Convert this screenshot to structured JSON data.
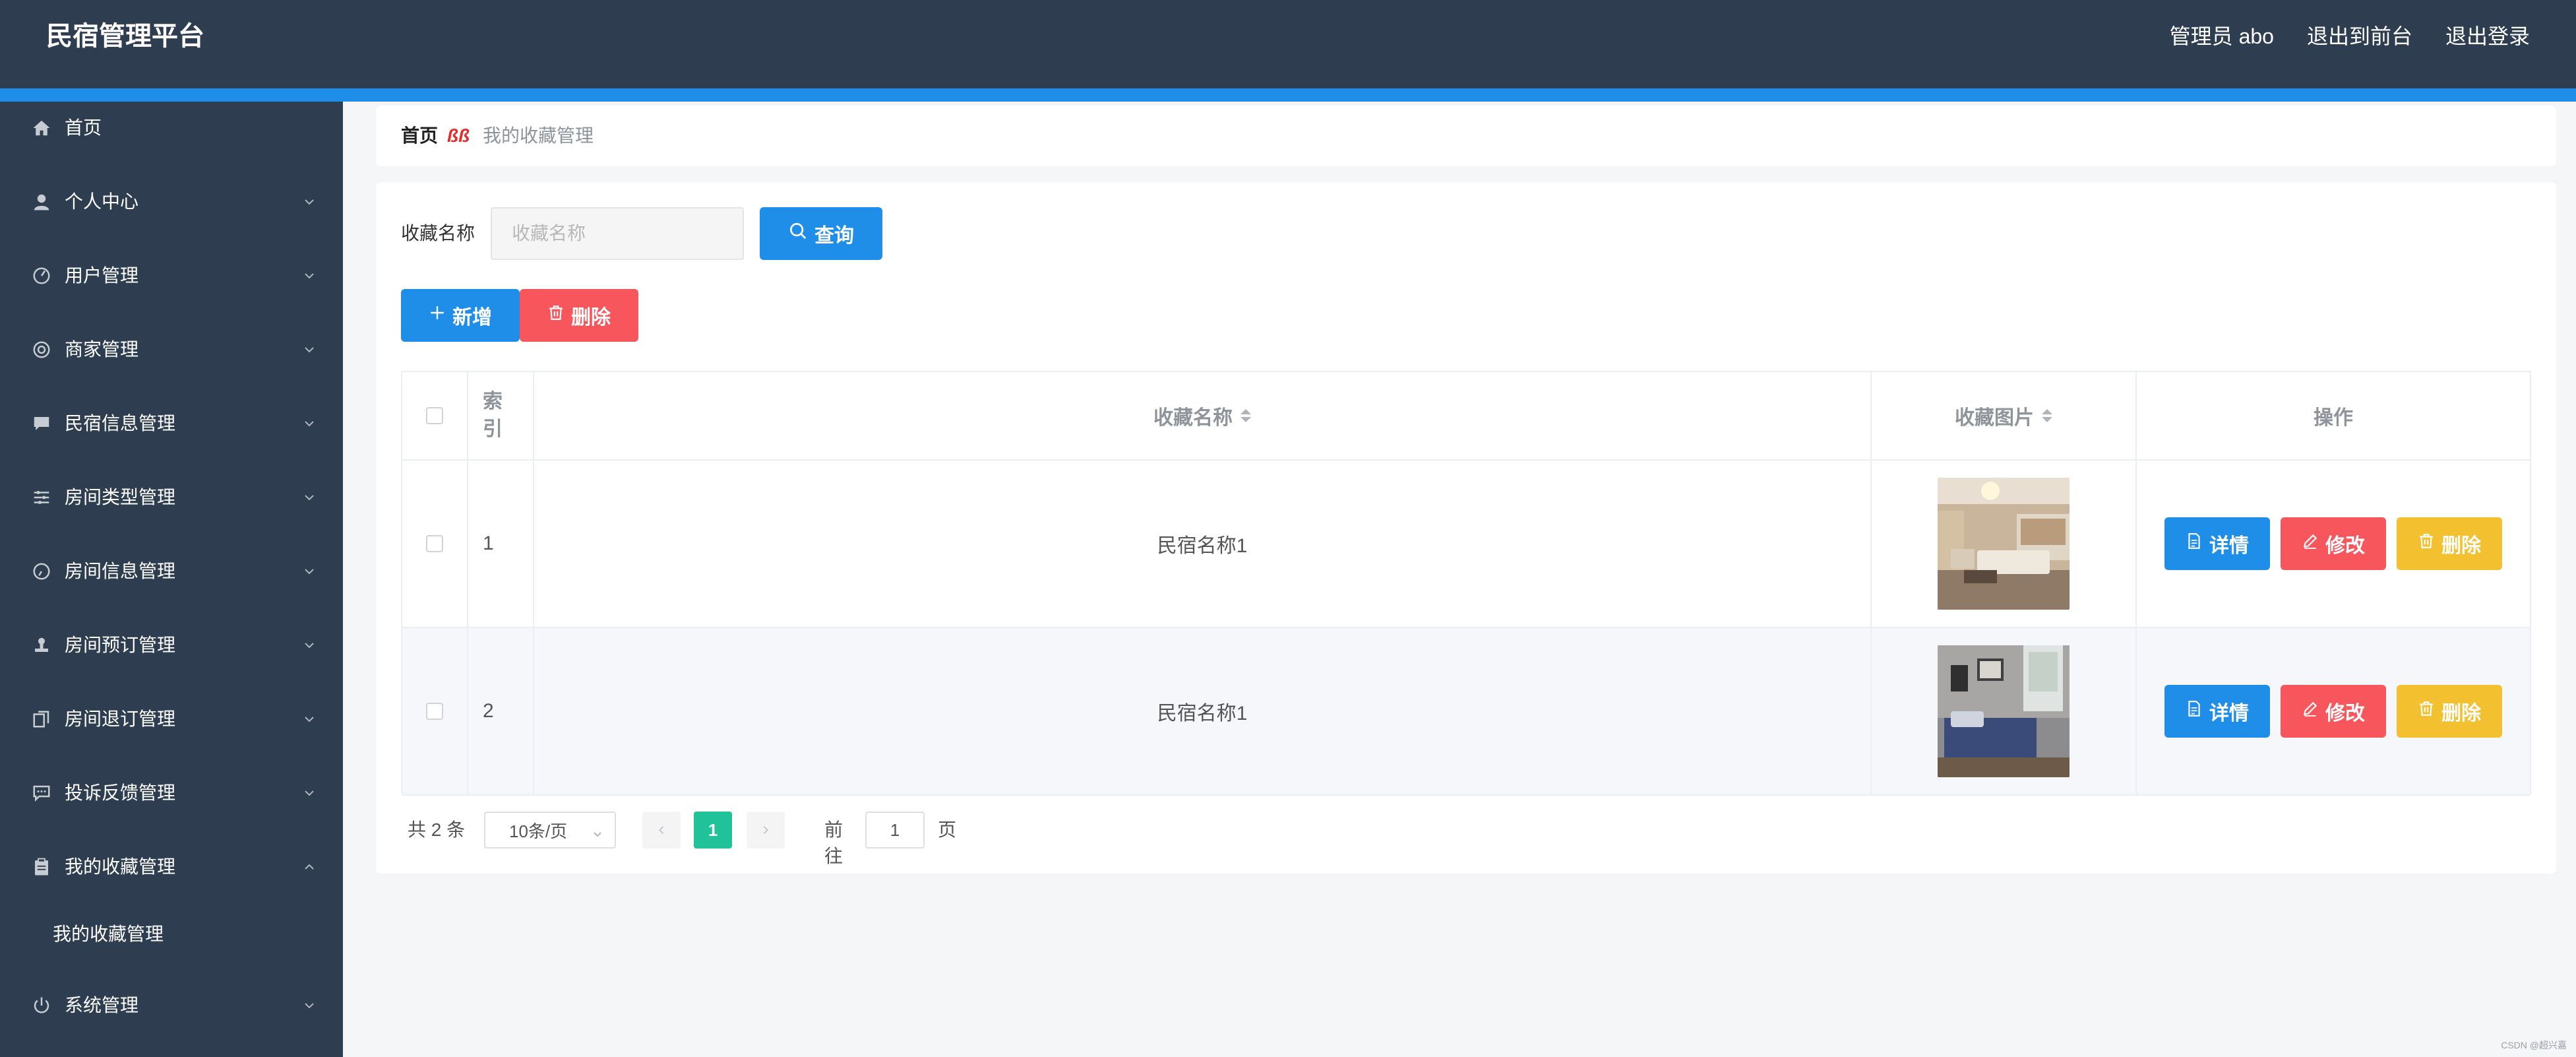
{
  "app": {
    "title": "民宿管理平台"
  },
  "header": {
    "user": "管理员 abo",
    "to_front": "退出到前台",
    "logout": "退出登录"
  },
  "colors": {
    "topbar": "#2e3d4f",
    "accent": "#1f8ee8",
    "danger": "#f6565c",
    "warning": "#f3c12f",
    "pager_active": "#20c29a"
  },
  "sidebar": {
    "items": [
      {
        "label": "首页",
        "icon": "home-icon"
      },
      {
        "label": "个人中心",
        "icon": "user-icon"
      },
      {
        "label": "用户管理",
        "icon": "dashboard-icon"
      },
      {
        "label": "商家管理",
        "icon": "shop-icon"
      },
      {
        "label": "民宿信息管理",
        "icon": "message-icon"
      },
      {
        "label": "房间类型管理",
        "icon": "sliders-icon"
      },
      {
        "label": "房间信息管理",
        "icon": "gauge-icon"
      },
      {
        "label": "房间预订管理",
        "icon": "stamp-icon"
      },
      {
        "label": "房间退订管理",
        "icon": "copy-icon"
      },
      {
        "label": "投诉反馈管理",
        "icon": "chat-icon"
      },
      {
        "label": "我的收藏管理",
        "icon": "clipboard-icon",
        "expanded": true
      },
      {
        "label": "系统管理",
        "icon": "power-icon"
      }
    ],
    "sub_item": "我的收藏管理"
  },
  "breadcrumb": {
    "home": "首页",
    "separator": "ßß",
    "current": "我的收藏管理"
  },
  "search": {
    "label": "收藏名称",
    "placeholder": "收藏名称",
    "button": "查询"
  },
  "actions": {
    "add": "新增",
    "delete": "删除"
  },
  "table": {
    "headers": {
      "index": "索引",
      "name": "收藏名称",
      "image": "收藏图片",
      "ops": "操作"
    },
    "rows": [
      {
        "index": "1",
        "name": "民宿名称1"
      },
      {
        "index": "2",
        "name": "民宿名称1"
      }
    ],
    "row_buttons": {
      "detail": "详情",
      "edit": "修改",
      "delete": "删除"
    }
  },
  "pagination": {
    "total": "共 2 条",
    "page_size": "10条/页",
    "current_page": "1",
    "goto": "前往",
    "goto_value": "1",
    "page_suffix": "页"
  },
  "watermark": "CSDN @超兴嘉"
}
